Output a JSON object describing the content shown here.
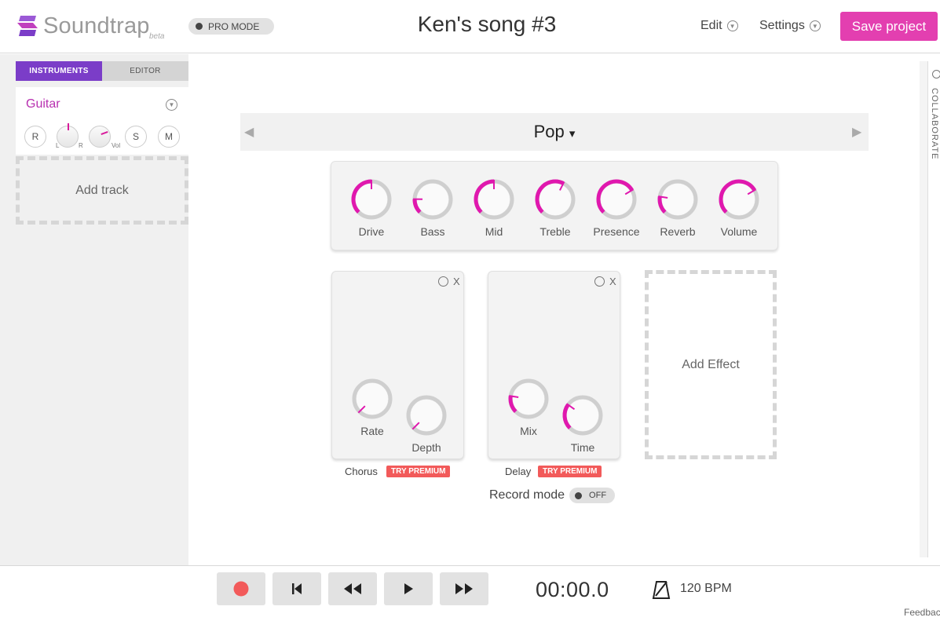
{
  "app": {
    "logo_text": "Soundtrap",
    "logo_badge": "beta",
    "pro_mode_label": "PRO MODE",
    "song_title": "Ken's song #3",
    "menu": {
      "edit_label": "Edit",
      "settings_label": "Settings"
    },
    "save_label": "Save project",
    "accent_color": "#e33fb0",
    "purple_color": "#7b3dc8"
  },
  "sidebar": {
    "tabs": [
      {
        "label": "INSTRUMENTS",
        "active": true
      },
      {
        "label": "EDITOR",
        "active": false
      }
    ],
    "track": {
      "name": "Guitar",
      "rec_label": "R",
      "pan_left_label": "L",
      "pan_right_label": "R",
      "vol_label": "Vol",
      "solo_label": "S",
      "mute_label": "M"
    },
    "add_track_label": "Add track"
  },
  "preset": {
    "name": "Pop",
    "dropdown_arrow": "▾",
    "prev_icon": "◀",
    "next_icon": "▶"
  },
  "amp_knobs": [
    {
      "label": "Drive",
      "level": 0.5
    },
    {
      "label": "Bass",
      "level": 0.17
    },
    {
      "label": "Mid",
      "level": 0.5
    },
    {
      "label": "Treble",
      "level": 0.6
    },
    {
      "label": "Presence",
      "level": 0.72
    },
    {
      "label": "Reverb",
      "level": 0.2
    },
    {
      "label": "Volume",
      "level": 0.72
    }
  ],
  "effects": [
    {
      "name": "Chorus",
      "close_label": "X",
      "premium_label": "TRY PREMIUM",
      "knobs": [
        {
          "label": "Rate",
          "level": 0.0
        },
        {
          "label": "Depth",
          "level": 0.0
        }
      ]
    },
    {
      "name": "Delay",
      "close_label": "X",
      "premium_label": "TRY PREMIUM",
      "knobs": [
        {
          "label": "Mix",
          "level": 0.2
        },
        {
          "label": "Time",
          "level": 0.3
        }
      ]
    }
  ],
  "add_effect_label": "Add Effect",
  "record_mode": {
    "label": "Record mode",
    "state": "OFF"
  },
  "transport": {
    "time": "00:00.0",
    "bpm": "120 BPM",
    "record_color": "#f25a5a"
  },
  "collaborate_label": "COLLABORATE",
  "feedback_label": "Feedback"
}
